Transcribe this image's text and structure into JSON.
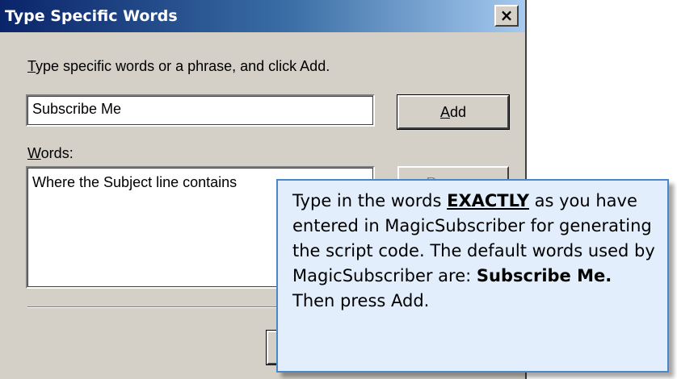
{
  "dialog": {
    "title": "Type Specific Words",
    "close_glyph": "×",
    "instruction": {
      "accel": "T",
      "rest": "ype specific words or a phrase, and click Add."
    },
    "input_value": "Subscribe Me",
    "add_button": {
      "accel": "A",
      "rest": "dd"
    },
    "words_label": {
      "accel": "W",
      "rest": "ords:"
    },
    "words_list": [
      "Where the Subject line contains"
    ],
    "remove_button": {
      "label": "Remove"
    }
  },
  "callout": {
    "part1": "Type in the words ",
    "emphasis": "EXACTLY",
    "part2": " as you have entered in MagicSubscriber for generating the script code. The default words used by MagicSubscriber are: ",
    "default_words": "Subscribe Me.",
    "part3": " Then press Add."
  },
  "colors": {
    "dialog_face": "#d4d0c8",
    "titlebar_start": "#0a246a",
    "titlebar_end": "#a6caf0",
    "callout_fill": "#e2eefb",
    "callout_border": "#4a86c8"
  }
}
